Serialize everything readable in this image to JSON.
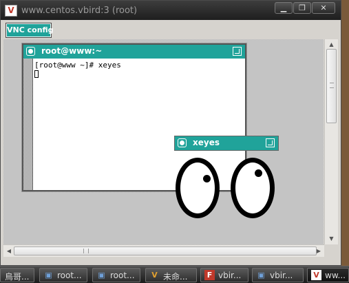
{
  "outer_window": {
    "title": "www.centos.vbird:3 (root)",
    "icon_letter": "V",
    "minimize": "▁",
    "maximize": "❐",
    "close": "✕"
  },
  "vnc_config": {
    "label": "VNC config"
  },
  "terminal": {
    "title": "root@www:~",
    "prompt_line": "[root@www ~]# xeyes"
  },
  "xeyes": {
    "title": "xeyes"
  },
  "scrollbar": {
    "up": "▲",
    "down": "▼",
    "left": "◀",
    "right": "▶"
  },
  "taskbar": {
    "items": [
      {
        "label": "烏哥...",
        "icon": ""
      },
      {
        "label": "root...",
        "icon": "▣"
      },
      {
        "label": "root...",
        "icon": "▣"
      },
      {
        "label": "未命...",
        "icon": "V"
      },
      {
        "label": "vbir...",
        "icon": "F"
      },
      {
        "label": "vbir...",
        "icon": "▣"
      },
      {
        "label": "ww...",
        "icon": "V"
      }
    ]
  },
  "colors": {
    "accent_teal": "#20a39a",
    "taskbar": "#2d2d2d"
  }
}
